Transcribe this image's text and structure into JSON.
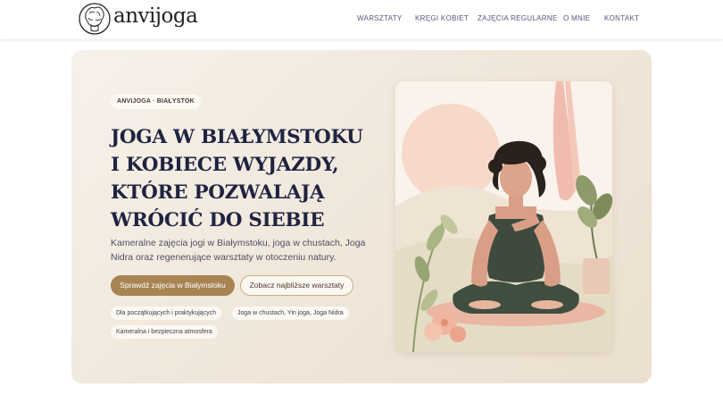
{
  "brand": {
    "name": "anvijoga"
  },
  "nav": {
    "items": [
      {
        "label": "WARSZTATY"
      },
      {
        "label": "KRĘGI KOBIET"
      },
      {
        "label": "ZAJĘCIA REGULARNE"
      },
      {
        "label": "O MNIE"
      },
      {
        "label": "KONTAKT"
      }
    ]
  },
  "hero": {
    "badge": "ANVIJOGA · BIAŁYSTOK",
    "title": "JOGA W BIAŁYMSTOKU I KOBIECE WYJAZDY, KTÓRE POZWALAJĄ WRÓCIĆ DO SIEBIE",
    "description": "Kameralne zajęcia jogi w Białymstoku, joga w chustach, Joga Nidra oraz regenerujące warsztaty w otoczeniu natury.",
    "primary_button": "Sprawdź zajęcia w Białymstoku",
    "secondary_button": "Zobacz najbliższe warsztaty",
    "chips": [
      {
        "label": "Dla początkujących i praktykujących"
      },
      {
        "label": "Joga w chustach, Yin joga, Joga Nidra"
      },
      {
        "label": "Kameralna i bezpieczna atmosfera"
      }
    ]
  },
  "colors": {
    "accent": "#a98453",
    "heading": "#1f2340",
    "nav_text": "#55567a"
  }
}
